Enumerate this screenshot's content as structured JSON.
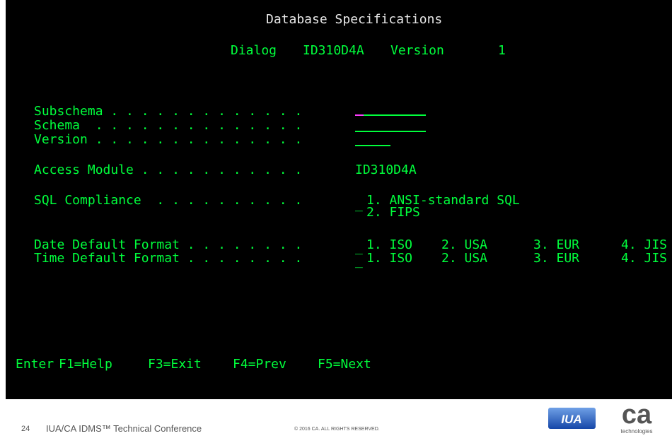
{
  "screen": {
    "title": "Database Specifications",
    "dialog_label": "Dialog",
    "dialog_name": "ID310D4A",
    "version_label": "Version",
    "version_value": "1"
  },
  "fields": {
    "subschema": {
      "label": "Subschema . . . . . . . . . . . . .",
      "value": ""
    },
    "schema": {
      "label": "Schema  . . . . . . . . . . . . . .",
      "value": ""
    },
    "version": {
      "label": "Version . . . . . . . . . . . . . .",
      "value": ""
    },
    "access_module": {
      "label": "Access Module . . . . . . . . . . .",
      "value": "ID310D4A"
    },
    "sql_compliance": {
      "label": "SQL Compliance  . . . . . . . . . .",
      "value": "_",
      "option1": "1. ANSI-standard SQL",
      "option2": "2. FIPS"
    },
    "date_format": {
      "label": "Date Default Format . . . . . . . .",
      "value": "_",
      "opt1": "1. ISO",
      "opt2": "2. USA",
      "opt3": "3. EUR",
      "opt4": "4. JIS"
    },
    "time_format": {
      "label": "Time Default Format . . . . . . . .",
      "value": "_",
      "opt1": "1. ISO",
      "opt2": "2. USA",
      "opt3": "3. EUR",
      "opt4": "4. JIS"
    }
  },
  "pf_keys": {
    "enter": "Enter",
    "f1": "F1=Help",
    "f3": "F3=Exit",
    "f4": "F4=Prev",
    "f5": "F5=Next"
  },
  "footer": {
    "slide_number": "24",
    "conference": "IUA/CA IDMS™ Technical Conference",
    "copyright": "© 2016 CA. ALL RIGHTS RESERVED.",
    "iua_logo_text": "IUA",
    "ca_logo_text": "ca",
    "ca_logo_subtext": "technologies"
  },
  "colors": {
    "terminal_bg": "#000000",
    "field_green": "#00ff3c",
    "title_white": "#e8e8e8",
    "cursor_magenta": "#ff3cff",
    "iua_blue": "#1f5fbf"
  }
}
